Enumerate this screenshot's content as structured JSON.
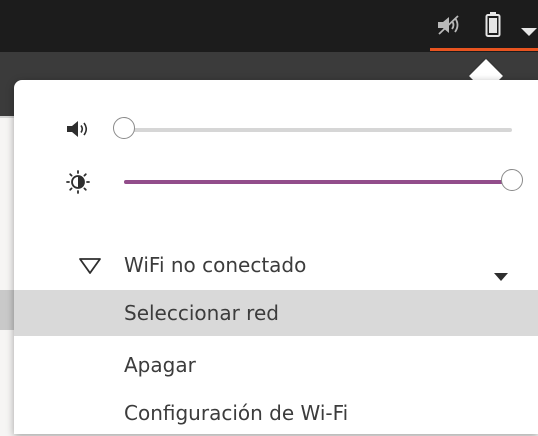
{
  "topbar": {
    "icons": [
      "speaker-muted-icon",
      "battery-icon",
      "dropdown-arrow-icon"
    ]
  },
  "menu": {
    "volume": {
      "icon": "speaker-icon",
      "level": 0.0
    },
    "brightness": {
      "icon": "brightness-icon",
      "level": 1.0
    },
    "wifi": {
      "icon": "wifi-icon",
      "label": "WiFi no conectado",
      "items": [
        "Seleccionar red",
        "Apagar",
        "Configuración de Wi-Fi"
      ]
    }
  },
  "colors": {
    "accent_orange": "#e95420",
    "slider_purple": "#924d8b"
  }
}
